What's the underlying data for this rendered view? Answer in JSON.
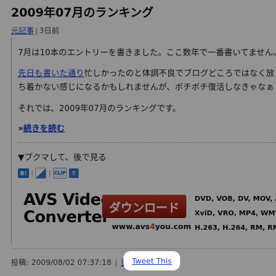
{
  "post": {
    "title": "2009年07月のランキング",
    "source_link": "元記事",
    "age": "3日前",
    "p1": "7月は10本のエントリーを書きました。ここ数年で一番書いてません。",
    "p2_link": "先日も書いた通り",
    "p2_rest_line1": "忙しかったのと体調不良でブログどころではなく放",
    "p2_line2": "ち着かない感じになるかもしれませんが、ボチボチ復活しなきゃなぁ",
    "p3": "それでは、2009年07月のランキングです。",
    "more_prefix": "»",
    "more_link": "続きを読む"
  },
  "bookmark": {
    "heading": "▼ブクマして、後で見る",
    "icons": [
      {
        "name": "hatena-bookmark-icon",
        "label": "B!"
      },
      {
        "name": "delicious-icon",
        "label": ""
      },
      {
        "name": "clip-icon",
        "label": "CLIP"
      },
      {
        "name": "question-icon",
        "label": "?"
      }
    ]
  },
  "ad": {
    "logo_line1": "AVS Video",
    "logo_line2": "Converter",
    "button": "ダウンロード",
    "url_pre": "www.avs",
    "url_mid": "4",
    "url_post": "you.com",
    "formats_line1": "DVD, VOB, DV, MOV, AV",
    "formats_line2": "XviD, VRO, MP4, WMV,",
    "formats_line3": "H.263, H.264, RM, RMV"
  },
  "footer": {
    "posted": "投稿: 2009/08/02 07:37:18",
    "register": "登録",
    "tweet": "Tweet This"
  }
}
